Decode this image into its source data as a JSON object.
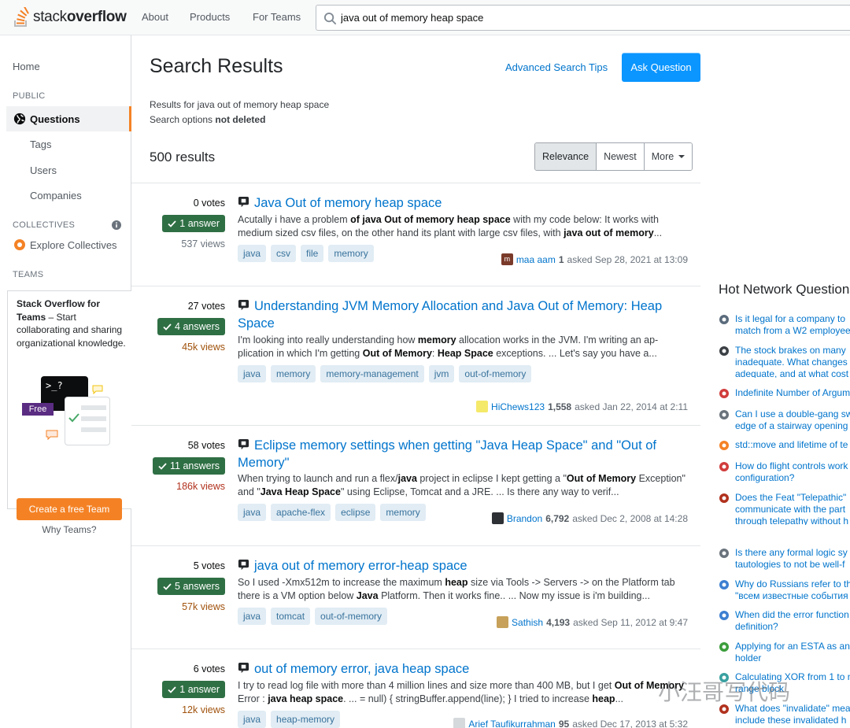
{
  "topbar": {
    "logo_prefix": "stack",
    "logo_suffix": "overflow",
    "nav": [
      "About",
      "Products",
      "For Teams"
    ],
    "search_value": "java out of memory heap space"
  },
  "sidebar": {
    "home": "Home",
    "public_heading": "PUBLIC",
    "questions": "Questions",
    "tags": "Tags",
    "users": "Users",
    "companies": "Companies",
    "collectives_heading": "COLLECTIVES",
    "explore_collectives": "Explore Collectives",
    "teams_heading": "TEAMS",
    "teams_title": "Stack Overflow for Teams",
    "teams_body": "– Start collaborating and sharing organizational knowledge.",
    "illus_prompt": ">_?",
    "illus_badge": "Free",
    "create_team": "Create a free Team",
    "why_teams": "Why Teams?"
  },
  "main": {
    "title": "Search Results",
    "advanced_tips": "Advanced Search Tips",
    "ask_button": "Ask Question",
    "results_for": "Results for java out of memory heap space",
    "search_options_label": "Search options",
    "search_options_value": "not deleted",
    "result_count": "500 results",
    "sort": {
      "relevance": "Relevance",
      "newest": "Newest",
      "more": "More"
    }
  },
  "questions": [
    {
      "votes": "0 votes",
      "answers": "1 answer",
      "views": "537 views",
      "title": "Java Out of memory heap space",
      "excerpt": "Acutally i have a problem <b>of java Out of memory heap space</b> with my code below: It works with medium sized csv files, on the other hand its plant with large csv files, with <b>java out of memory</b>...",
      "tags": [
        "java",
        "csv",
        "file",
        "memory"
      ],
      "user": "maa aam",
      "rep": "1",
      "asked": "asked Sep 28, 2021 at 13:09"
    },
    {
      "votes": "27 votes",
      "answers": "4 answers",
      "views": "45k views",
      "title": "Understanding JVM Memory Allocation and Java Out of Memory: Heap Space",
      "excerpt": "I'm looking into really understanding how <b>memory</b> allocation works in the JVM. I'm writing an ap­plication in which I'm getting <b>Out of Memory</b>: <b>Heap Space</b> exceptions. ... Let's say you have a...",
      "tags": [
        "java",
        "memory",
        "memory-management",
        "jvm",
        "out-of-memory"
      ],
      "user": "HiChews123",
      "rep": "1,558",
      "asked": "asked Jan 22, 2014 at 2:11"
    },
    {
      "votes": "58 votes",
      "answers": "11 answers",
      "views": "186k views",
      "title": "Eclipse memory settings when getting \"Java Heap Space\" and \"Out of Memory\"",
      "excerpt": "When trying to launch and run a flex/<b>java</b> project in eclipse I kept getting a \"<b>Out of Memory</b> Exception\" and \"<b>Java Heap Space</b>\" using Eclipse, Tomcat and a JRE. ... Is there any way to verif...",
      "tags": [
        "java",
        "apache-flex",
        "eclipse",
        "memory"
      ],
      "user": "Brandon",
      "rep": "6,792",
      "asked": "asked Dec 2, 2008 at 14:28"
    },
    {
      "votes": "5 votes",
      "answers": "5 answers",
      "views": "57k views",
      "title": "java out of memory error-heap space",
      "excerpt": "So I used -Xmx512m to increase the maximum <b>heap</b> size via Tools -> Servers -> on the Platform tab there is a VM option below <b>Java</b> Platform. Then it works fine.. ... Now my issue is i'm building...",
      "tags": [
        "java",
        "tomcat",
        "out-of-memory"
      ],
      "user": "Sathish",
      "rep": "4,193",
      "asked": "asked Sep 11, 2012 at 9:47"
    },
    {
      "votes": "6 votes",
      "answers": "1 answer",
      "views": "12k views",
      "title": "out of memory error, java heap space",
      "excerpt": "I try to read log file with more than 4 million lines and size more than 400 MB, but I get <b>Out of Memory</b> Error : <b>java heap space</b>. ... = null) { stringBuffer.append(line); } I tried to increase <b>heap</b>...",
      "tags": [
        "java",
        "heap-memory"
      ],
      "user": "Arief Taufikurrahman",
      "rep": "95",
      "asked": "asked Dec 17, 2013 at 5:32"
    }
  ],
  "hot_network": {
    "title": "Hot Network Questions",
    "items": [
      {
        "text": "Is it legal for a company to\nmatch from a W2 employee",
        "icon": "vehicle-icon",
        "color": "#5a6b7c"
      },
      {
        "text": "The stock brakes on many\ninadequate. What changes\nadequate, and at what cost",
        "icon": "bike-icon",
        "color": "#3b4045"
      },
      {
        "text": "Indefinite Number of Argum",
        "icon": "braces-icon",
        "color": "#d13c3c"
      },
      {
        "text": "Can I use a double-gang sw\nedge of a stairway opening",
        "icon": "gear-icon",
        "color": "#6a737c"
      },
      {
        "text": "std::move and lifetime of te",
        "icon": "stackoverflow-icon",
        "color": "#f48225"
      },
      {
        "text": "How do flight controls work\nconfiguration?",
        "icon": "aviation-icon",
        "color": "#d13c3c"
      },
      {
        "text": "Does the Feat \"Telepathic\"\ncommunicate with the part\nthrough telepathy without h\nbeast form?",
        "icon": "dice-icon",
        "color": "#b1311d"
      },
      {
        "text": "Is there any formal logic sy\ntautologies to not be well-f",
        "icon": "philosophy-icon",
        "color": "#6a737c"
      },
      {
        "text": "Why do Russians refer to th\n\"всем известные события",
        "icon": "russian-icon",
        "color": "#3d7fd1"
      },
      {
        "text": "When did the error function\ndefinition?",
        "icon": "hsm-icon",
        "color": "#3d7fd1"
      },
      {
        "text": "Applying for an ESTA as an\nholder",
        "icon": "travel-icon",
        "color": "#3b9d3b"
      },
      {
        "text": "Calculating XOR from 1 to n\nrange block",
        "icon": "codegolf-icon",
        "color": "#3aa0a0"
      },
      {
        "text": "What does \"invalidate\" mea\ninclude these invalidated h",
        "icon": "law-icon",
        "color": "#b1311d"
      }
    ]
  },
  "watermark": "小汪哥写代码"
}
